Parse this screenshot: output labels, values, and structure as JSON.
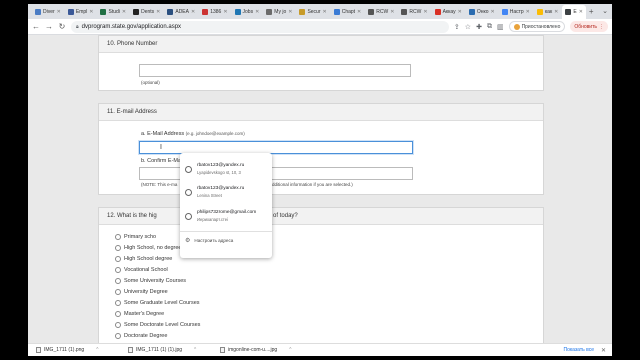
{
  "browser": {
    "tabs": [
      {
        "label": "Diver",
        "color": "#4a7cc4"
      },
      {
        "label": "Empl",
        "color": "#3b5998"
      },
      {
        "label": "Studi",
        "color": "#1f6f43"
      },
      {
        "label": "Dents",
        "color": "#222222"
      },
      {
        "label": "ADEA",
        "color": "#2a4f7f"
      },
      {
        "label": "1386",
        "color": "#cc3333"
      },
      {
        "label": "Jobs",
        "color": "#1f77b4"
      },
      {
        "label": "My jo",
        "color": "#6b6b6b"
      },
      {
        "label": "Secur",
        "color": "#c79b2a"
      },
      {
        "label": "Chapt",
        "color": "#3a7bd5"
      },
      {
        "label": "RCW",
        "color": "#555555"
      },
      {
        "label": "RCW",
        "color": "#555555"
      },
      {
        "label": "Аккау",
        "color": "#d93025"
      },
      {
        "label": "Онко",
        "color": "#2b6cb0"
      },
      {
        "label": "Настр",
        "color": "#4285f4"
      },
      {
        "label": "как",
        "color": "#fbbc04"
      },
      {
        "label": "E",
        "color": "#3c4043",
        "active": true
      }
    ],
    "url": "dvprogram.state.gov/application.aspx",
    "profile_status": "Приостановлено",
    "update_label": "Обновить"
  },
  "form": {
    "phone": {
      "title": "10. Phone Number",
      "note": "(optional)"
    },
    "email": {
      "title": "11. E-mail Address",
      "a_label": "a. E-Mail Address",
      "a_hint": "(e.g. johndoe@example.com)",
      "b_label": "b. Confirm E-Ma",
      "note_left": "(NOTE: This e-ma",
      "note_right": "dditional information if you are selected.)"
    },
    "education": {
      "title_left": "12. What is the hig",
      "title_right": "eved, as of today?",
      "options": [
        "Primary scho",
        "High School, no degree",
        "High School degree",
        "Vocational School",
        "Some University Courses",
        "University Degree",
        "Some Graduate Level Courses",
        "Master's Degree",
        "Some Doctorate Level Courses",
        "Doctorate Degree"
      ]
    }
  },
  "autofill": {
    "suggestions": [
      {
        "email": "rbatov123@yandex.ru",
        "address": "Lyapidevskogo st, 10, 3"
      },
      {
        "email": "rbatov123@yandex.ru",
        "address": "Lenina Street"
      },
      {
        "email": "philips732rome@gmail.com",
        "address": "Иерихапарт.стеі"
      }
    ],
    "manage_label": "Настроить адреса"
  },
  "downloads": {
    "items": [
      "IMG_1711 (1).png",
      "IMG_1711 (1) (1).jpg",
      "imgonline-com-u....jpg"
    ],
    "show_all": "Показать все"
  }
}
